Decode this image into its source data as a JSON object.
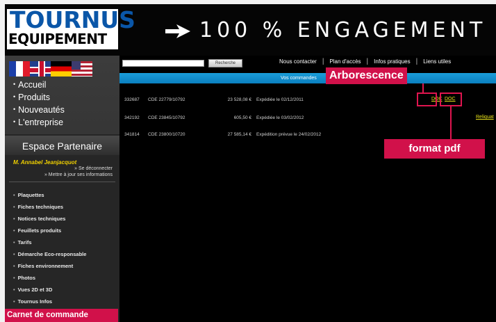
{
  "header": {
    "logo_line1": "TOURNUS",
    "logo_line2": "EQUIPEMENT",
    "banner": "100 % ENGAGEMENT"
  },
  "sidebar": {
    "main_nav": [
      "Accueil",
      "Produits",
      "Nouveautés",
      "L'entreprise"
    ],
    "partner": {
      "title": "Espace Partenaire",
      "user": "M. Annabel Jeanjacquot",
      "logout": "Se déconnecter",
      "update": "Mettre à jour ses informations"
    },
    "doc_nav": [
      "Plaquettes",
      "Fiches techniques",
      "Notices techniques",
      "Feuillets produits",
      "Tarifs",
      "Démarche Eco-responsable",
      "Fiches environnement",
      "Photos",
      "Vues 2D et 3D",
      "Tournus Infos"
    ]
  },
  "topbar": {
    "search_placeholder": "",
    "search_button": "Recherche",
    "links": [
      "Nous contacter",
      "Plan d'accès",
      "Infos pratiques",
      "Liens utiles"
    ]
  },
  "orders_header": "Vos commandes",
  "orders": [
    {
      "num": "332687",
      "cde": "CDE 22779/10792",
      "amount": "23 528,08 €",
      "status": "Expédiée le 02/12/2011",
      "docs": [
        "DOC",
        "DOC"
      ]
    },
    {
      "num": "342192",
      "cde": "CDE 23845/10792",
      "amount": "605,50 €",
      "status": "Expédiée le 03/02/2012",
      "reliquat": "Reliquat"
    },
    {
      "num": "341814",
      "cde": "CDE 23800/10720",
      "amount": "27 585,14 €",
      "status": "Expédition prévue le 24/02/2012"
    }
  ],
  "annotations": {
    "arborescence": "Arborescence",
    "format_pdf": "format pdf",
    "carnet": "Carnet de commande"
  },
  "colors": {
    "annotation": "#d1114a",
    "accent_bar": "#1a9dd9",
    "doc_link": "#e7e11a",
    "logo_blue": "#0a56a8"
  }
}
